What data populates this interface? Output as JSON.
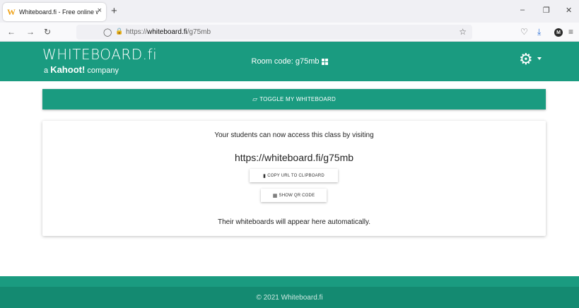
{
  "browser": {
    "tab_favicon": "W",
    "tab_title": "Whiteboard.fi - Free online whi",
    "tab_close": "×",
    "new_tab": "+",
    "minimize": "–",
    "restore": "❐",
    "close": "✕",
    "back": "←",
    "forward": "→",
    "reload": "↻",
    "shield": "◯",
    "lock": "🔒",
    "url_prefix": "https://",
    "url_host": "whiteboard.fi",
    "url_path": "/g75mb",
    "star": "☆",
    "pocket": "♡",
    "download": "⤓",
    "account": "M",
    "menu": "≡"
  },
  "header": {
    "logo": "WHITEBOARD.fi",
    "logo_sub_prefix": "a",
    "logo_sub_brand": "Kahoot!",
    "logo_sub_suffix": "company",
    "room_code_label": "Room code: g75mb",
    "gear": "⚙"
  },
  "main": {
    "toggle_icon": "▱",
    "toggle_label": "TOGGLE MY WHITEBOARD",
    "access_text": "Your students can now access this class by visiting",
    "class_url": "https://whiteboard.fi/g75mb",
    "copy_icon": "▮",
    "copy_label": "COPY URL TO CLIPBOARD",
    "qr_icon": "▦",
    "qr_label": "SHOW QR CODE",
    "auto_text": "Their whiteboards will appear here automatically."
  },
  "footer": {
    "copyright": "© 2021 Whiteboard.fi"
  }
}
